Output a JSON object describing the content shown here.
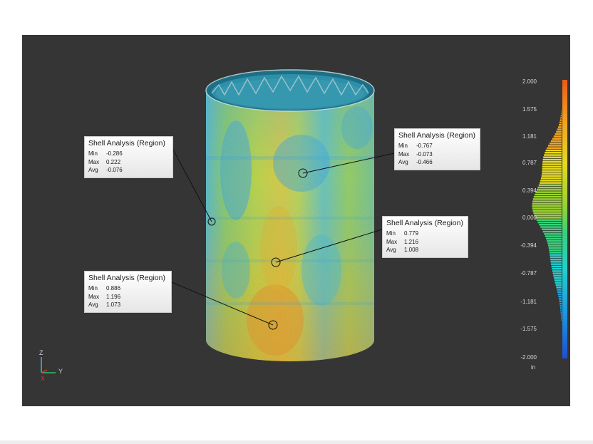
{
  "callouts": [
    {
      "title": "Shell Analysis (Region)",
      "rows": [
        [
          "Min",
          "-0.286"
        ],
        [
          "Max",
          "0.222"
        ],
        [
          "Avg",
          "-0.076"
        ]
      ]
    },
    {
      "title": "Shell Analysis (Region)",
      "rows": [
        [
          "Min",
          "-0.767"
        ],
        [
          "Max",
          "-0.073"
        ],
        [
          "Avg",
          "-0.466"
        ]
      ]
    },
    {
      "title": "Shell Analysis (Region)",
      "rows": [
        [
          "Min",
          "0.779"
        ],
        [
          "Max",
          "1.216"
        ],
        [
          "Avg",
          "1.008"
        ]
      ]
    },
    {
      "title": "Shell Analysis (Region)",
      "rows": [
        [
          "Min",
          "0.886"
        ],
        [
          "Max",
          "1.196"
        ],
        [
          "Avg",
          "1.073"
        ]
      ]
    }
  ],
  "legend": {
    "ticks": [
      "2.000",
      "1.575",
      "1.181",
      "0.787",
      "0.394",
      "0.000",
      "-0.394",
      "-0.787",
      "-1.181",
      "-1.575",
      "-2.000"
    ],
    "unit": "in",
    "range": [
      -2.0,
      2.0
    ],
    "colors": [
      "#1e4fd1",
      "#1b9fe0",
      "#20d0d0",
      "#36d27a",
      "#9ad330",
      "#e6da1e",
      "#f2a21c",
      "#ee5a18"
    ]
  },
  "axes": {
    "z": "Z",
    "y": "Y",
    "x": "X"
  },
  "colors": {
    "viewport_bg": "#353535",
    "accent_red": "#e03030",
    "accent_green": "#30c060",
    "accent_cyan": "#30c0e0"
  }
}
